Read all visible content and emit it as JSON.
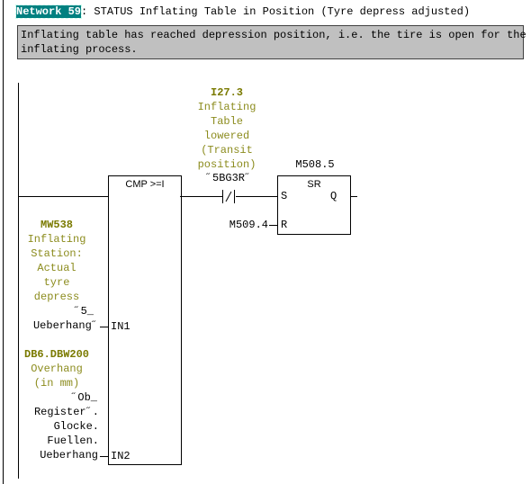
{
  "network": {
    "label": "Network 59",
    "title": ": STATUS Inflating Table in Position (Tyre depress adjusted)",
    "highlight_color": "#008080"
  },
  "comment": {
    "line1": "Inflating table has reached depression position, i.e. the tire is open for the",
    "line2": "inflating process."
  },
  "cmp": {
    "title": "CMP >=I",
    "in1_label": "IN1",
    "in2_label": "IN2"
  },
  "in1": {
    "address": "MW538",
    "comment": [
      "Inflating",
      "Station:",
      "Actual",
      "tyre",
      "depress"
    ],
    "symbol": [
      "˝5_",
      "Ueberhang˝"
    ]
  },
  "in2": {
    "address": "DB6.DBW200",
    "comment": [
      "Overhang",
      "(in mm)"
    ],
    "symbol": [
      "˝Ob_",
      "Register˝.",
      "Glocke.",
      "Fuellen.",
      "Ueberhang"
    ]
  },
  "contact": {
    "address": "I27.3",
    "comment": [
      "Inflating",
      "Table",
      "lowered",
      "(Transit",
      "position)"
    ],
    "symbol": "˝5BG3R˝",
    "type": "normally-closed"
  },
  "sr": {
    "address": "M508.5",
    "title": "SR",
    "s_label": "S",
    "r_label": "R",
    "q_label": "Q",
    "reset_operand": "M509.4"
  }
}
